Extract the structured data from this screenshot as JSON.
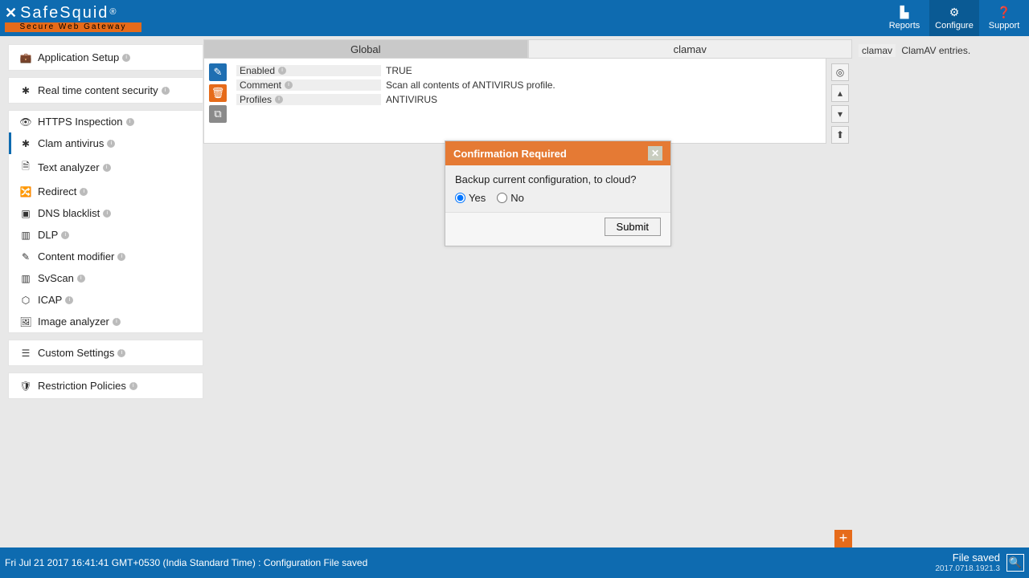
{
  "brand": {
    "name": "SafeSquid",
    "reg": "®",
    "tagline": "Secure Web Gateway"
  },
  "topnav": {
    "reports": "Reports",
    "configure": "Configure",
    "support": "Support"
  },
  "sidebar": {
    "groups": {
      "app_setup": "Application Setup",
      "rtcs": "Real time content security",
      "custom": "Custom Settings",
      "restrict": "Restriction Policies"
    },
    "rtcs_items": [
      "HTTPS Inspection",
      "Clam antivirus",
      "Text analyzer",
      "Redirect",
      "DNS blacklist",
      "DLP",
      "Content modifier",
      "SvScan",
      "ICAP",
      "Image analyzer"
    ]
  },
  "tabs": {
    "global": "Global",
    "clamav": "clamav"
  },
  "entry": {
    "enabled_k": "Enabled",
    "enabled_v": "TRUE",
    "comment_k": "Comment",
    "comment_v": "Scan all contents of ANTIVIRUS profile.",
    "profiles_k": "Profiles",
    "profiles_v": "ANTIVIRUS"
  },
  "rightinfo": {
    "tag": "clamav",
    "desc": "ClamAV entries."
  },
  "dialog": {
    "title": "Confirmation Required",
    "message": "Backup current configuration, to cloud?",
    "yes": "Yes",
    "no": "No",
    "submit": "Submit"
  },
  "footer": {
    "status": "Fri Jul 21 2017 16:41:41 GMT+0530 (India Standard Time) : Configuration File saved",
    "saved": "File saved",
    "version": "2017.0718.1921.3"
  }
}
